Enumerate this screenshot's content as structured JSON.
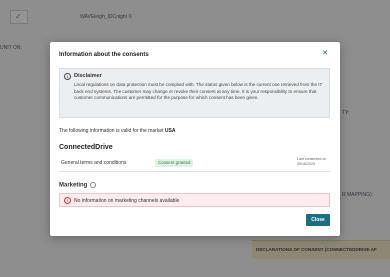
{
  "background": {
    "top_box_icon": "check-icon",
    "lines": [
      "WAVEleigh_IDCnight ©",
      "UNIT ON:",
      "TY:",
      "R MAPPING):"
    ],
    "yellow_label": "DECLARATIONS OF CONSENT (CONNECTEDDRIVE AF"
  },
  "modal": {
    "title": "Information about the consents",
    "close_icon": "close-icon",
    "disclaimer": {
      "icon": "info-icon",
      "title": "Disclaimer",
      "text": "Local regulations on data protection must be complied with. The status given below is the current one retrieved from the IT back end systems. The customer may change or revoke their consent at any time. It is your responsibility to ensure that customer communications are permitted for the purpose for which consent has been given."
    },
    "market_text": "The following information is valid for the market",
    "market": "USA",
    "section": {
      "title": "ConnectedDrive",
      "rows": [
        {
          "label": "General terms and conditions",
          "status": "Consent granted",
          "date_label": "Last consented on",
          "date": "05/18/2025"
        }
      ]
    },
    "marketing": {
      "title": "Marketing",
      "icon": "info-icon"
    },
    "alert": {
      "icon": "error-icon",
      "text": "No information on marketing channels available"
    },
    "close_button": "Close"
  },
  "colors": {
    "accent": "#1b6e83",
    "granted_bg": "#dff3e4",
    "granted_text": "#2e7d32",
    "alert_bg": "#fdecef"
  }
}
